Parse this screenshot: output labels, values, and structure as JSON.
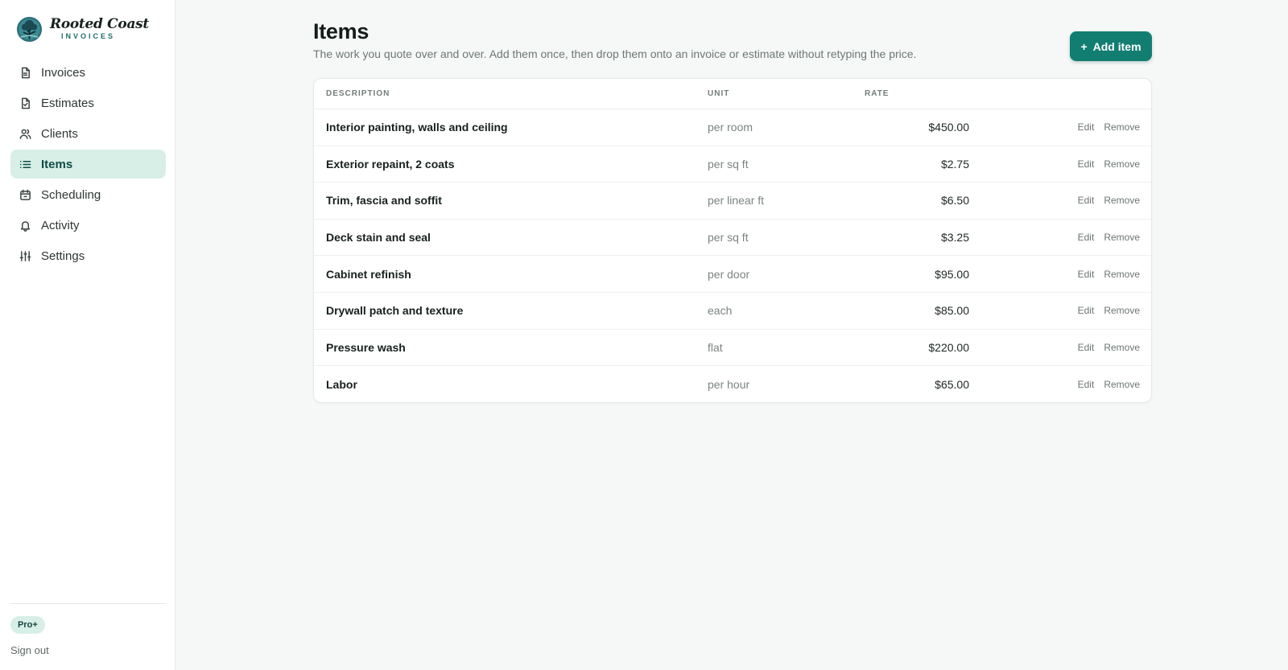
{
  "brand": {
    "name": "Rooted Coast",
    "sub": "INVOICES"
  },
  "nav": [
    {
      "label": "Invoices",
      "icon": "file-icon",
      "active": false
    },
    {
      "label": "Estimates",
      "icon": "file-check-icon",
      "active": false
    },
    {
      "label": "Clients",
      "icon": "users-icon",
      "active": false
    },
    {
      "label": "Items",
      "icon": "list-icon",
      "active": true
    },
    {
      "label": "Scheduling",
      "icon": "calendar-icon",
      "active": false
    },
    {
      "label": "Activity",
      "icon": "bell-icon",
      "active": false
    },
    {
      "label": "Settings",
      "icon": "sliders-icon",
      "active": false
    }
  ],
  "plan_badge": "Pro+",
  "sign_out": "Sign out",
  "page": {
    "title": "Items",
    "subtitle": "The work you quote over and over. Add them once, then drop them onto an invoice or estimate without retyping the price.",
    "add_button": "Add item",
    "add_button_icon": "+"
  },
  "table": {
    "columns": [
      "DESCRIPTION",
      "UNIT",
      "RATE"
    ],
    "edit_label": "Edit",
    "remove_label": "Remove",
    "rows": [
      {
        "description": "Interior painting, walls and ceiling",
        "unit": "per room",
        "rate": "$450.00"
      },
      {
        "description": "Exterior repaint, 2 coats",
        "unit": "per sq ft",
        "rate": "$2.75"
      },
      {
        "description": "Trim, fascia and soffit",
        "unit": "per linear ft",
        "rate": "$6.50"
      },
      {
        "description": "Deck stain and seal",
        "unit": "per sq ft",
        "rate": "$3.25"
      },
      {
        "description": "Cabinet refinish",
        "unit": "per door",
        "rate": "$95.00"
      },
      {
        "description": "Drywall patch and texture",
        "unit": "each",
        "rate": "$85.00"
      },
      {
        "description": "Pressure wash",
        "unit": "flat",
        "rate": "$220.00"
      },
      {
        "description": "Labor",
        "unit": "per hour",
        "rate": "$65.00"
      }
    ]
  },
  "colors": {
    "accent": "#127e72",
    "active_bg": "#d8efe8",
    "page_bg": "#f6f8f7"
  }
}
